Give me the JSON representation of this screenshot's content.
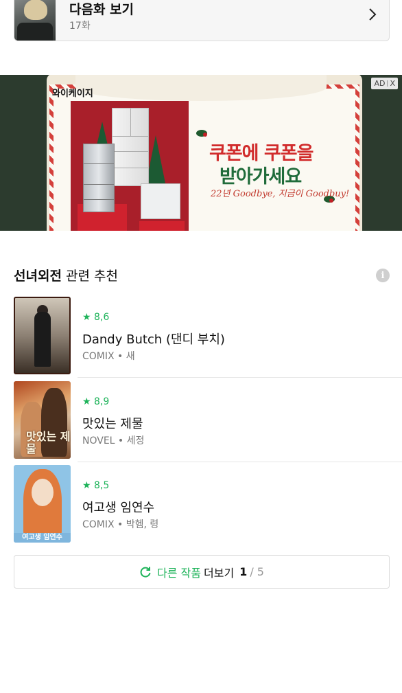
{
  "next_episode": {
    "title": "다음화 보기",
    "subtitle": "17화",
    "arrow_icon": "chevron-right-icon"
  },
  "ad": {
    "badge_label": "AD",
    "badge_close": "X",
    "brand": "와이케이지",
    "headline_line1": "쿠폰에 쿠폰을",
    "headline_line2": "받아가세요",
    "script_text": "22년 Goodbye, 지금이 Goodbuy!",
    "colors": {
      "background": "#2c3b2e",
      "red": "#d12c2c",
      "green": "#1f6b3a"
    }
  },
  "related": {
    "heading_bold": "선녀외전",
    "heading_rest": " 관련 추천",
    "info_icon": "i",
    "items": [
      {
        "rating": "★ 8,6",
        "title": "Dandy Butch (댄디 부치)",
        "meta": "COMIX • 새"
      },
      {
        "rating": "★ 8,9",
        "title": "맛있는 제물",
        "meta": "NOVEL • 세정",
        "cover_text": "맛있는 제물"
      },
      {
        "rating": "★ 8,5",
        "title": "여고생 임연수",
        "meta": "COMIX • 박헴, 령",
        "cover_text": "여고생 임연수"
      }
    ]
  },
  "more_button": {
    "label_green": "다른 작품",
    "label_dark": "더보기",
    "current_page": "1",
    "total_pages": "/ 5",
    "accent": "#1eb35a"
  }
}
